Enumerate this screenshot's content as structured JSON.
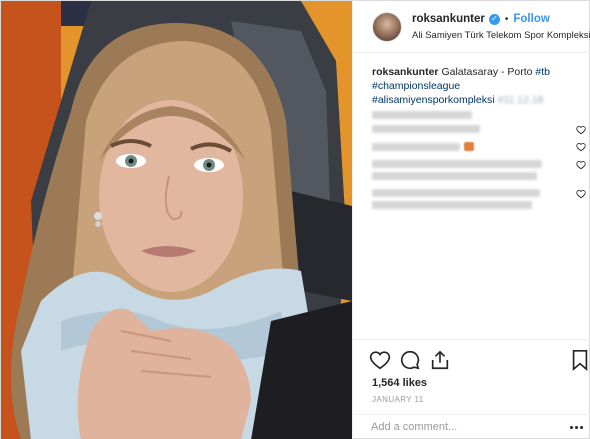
{
  "header": {
    "username": "roksankunter",
    "verified_icon": "verified-badge-icon",
    "separator": "•",
    "follow_label": "Follow",
    "location": "Ali Samiyen Türk Telekom Spor Kompleksi"
  },
  "caption": {
    "username": "roksankunter",
    "text": "Galatasaray - Porto",
    "hashtags": [
      "#tb",
      "#championsleague",
      "#alisamiyensporkompleksi"
    ],
    "obscured_tail": "#11.12.18"
  },
  "comments": {
    "accent_color": "#e3813c"
  },
  "actions": {
    "likes": "1,564 likes",
    "date": "JANUARY 11",
    "comment_placeholder": "Add a comment..."
  },
  "colors": {
    "link_blue": "#3897f0",
    "hashtag_navy": "#003569",
    "photo_background": "#e3942a"
  }
}
